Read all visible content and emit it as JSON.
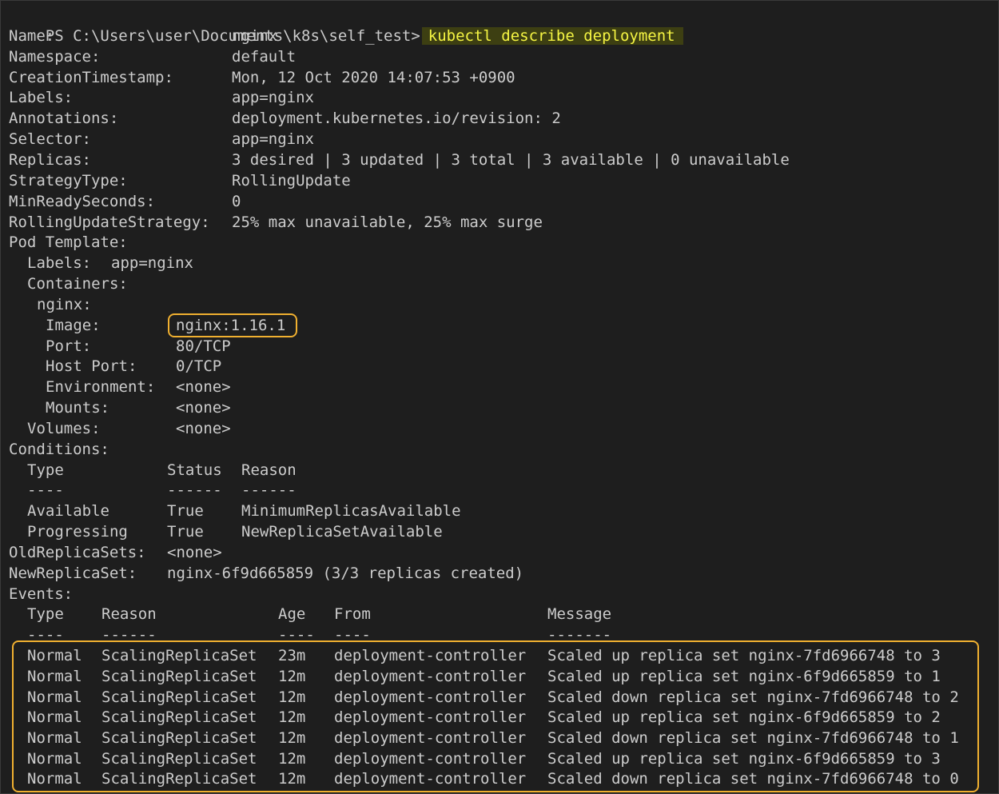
{
  "prompt": "PS C:\\Users\\user\\Documents\\k8s\\self_test>",
  "command": "kubectl describe deployment",
  "fields": [
    {
      "key": "Name:",
      "val": "nginx"
    },
    {
      "key": "Namespace:",
      "val": "default"
    },
    {
      "key": "CreationTimestamp:",
      "val": "Mon, 12 Oct 2020 14:07:53 +0900"
    },
    {
      "key": "Labels:",
      "val": "app=nginx"
    },
    {
      "key": "Annotations:",
      "val": "deployment.kubernetes.io/revision: 2"
    },
    {
      "key": "Selector:",
      "val": "app=nginx"
    },
    {
      "key": "Replicas:",
      "val": "3 desired | 3 updated | 3 total | 3 available | 0 unavailable"
    },
    {
      "key": "StrategyType:",
      "val": "RollingUpdate"
    },
    {
      "key": "MinReadySeconds:",
      "val": "0"
    },
    {
      "key": "RollingUpdateStrategy:",
      "val": "25% max unavailable, 25% max surge"
    }
  ],
  "pod_template": {
    "heading": "Pod Template:",
    "labels_key": "Labels:",
    "labels_val": "app=nginx",
    "containers_heading": "Containers:",
    "container_name": "nginx:",
    "image_key": "Image:",
    "image_val": "nginx:1.16.1",
    "port_key": "Port:",
    "port_val": "80/TCP",
    "host_port_key": "Host Port:",
    "host_port_val": "0/TCP",
    "env_key": "Environment:",
    "env_val": "<none>",
    "mounts_key": "Mounts:",
    "mounts_val": "<none>",
    "volumes_key": "Volumes:",
    "volumes_val": "<none>"
  },
  "conditions": {
    "heading": "Conditions:",
    "headers": [
      "Type",
      "Status",
      "Reason"
    ],
    "dashes": [
      "----",
      "------",
      "------"
    ],
    "rows": [
      [
        "Available",
        "True",
        "MinimumReplicasAvailable"
      ],
      [
        "Progressing",
        "True",
        "NewReplicaSetAvailable"
      ]
    ]
  },
  "old_rs_key": "OldReplicaSets:",
  "old_rs_val": "<none>",
  "new_rs_key": "NewReplicaSet:",
  "new_rs_val": "nginx-6f9d665859 (3/3 replicas created)",
  "events": {
    "heading": "Events:",
    "headers": [
      "Type",
      "Reason",
      "Age",
      "From",
      "Message"
    ],
    "dashes": [
      "----",
      "------",
      "----",
      "----",
      "-------"
    ],
    "rows": [
      [
        "Normal",
        "ScalingReplicaSet",
        "23m",
        "deployment-controller",
        "Scaled up replica set nginx-7fd6966748 to 3"
      ],
      [
        "Normal",
        "ScalingReplicaSet",
        "12m",
        "deployment-controller",
        "Scaled up replica set nginx-6f9d665859 to 1"
      ],
      [
        "Normal",
        "ScalingReplicaSet",
        "12m",
        "deployment-controller",
        "Scaled down replica set nginx-7fd6966748 to 2"
      ],
      [
        "Normal",
        "ScalingReplicaSet",
        "12m",
        "deployment-controller",
        "Scaled up replica set nginx-6f9d665859 to 2"
      ],
      [
        "Normal",
        "ScalingReplicaSet",
        "12m",
        "deployment-controller",
        "Scaled down replica set nginx-7fd6966748 to 1"
      ],
      [
        "Normal",
        "ScalingReplicaSet",
        "12m",
        "deployment-controller",
        "Scaled up replica set nginx-6f9d665859 to 3"
      ],
      [
        "Normal",
        "ScalingReplicaSet",
        "12m",
        "deployment-controller",
        "Scaled down replica set nginx-7fd6966748 to 0"
      ]
    ]
  },
  "colors": {
    "background": "#1e1e1e",
    "text": "#cccccc",
    "command_text": "#f5f543",
    "command_bg": "#3d3f12",
    "highlight_box": "#f0b030"
  }
}
